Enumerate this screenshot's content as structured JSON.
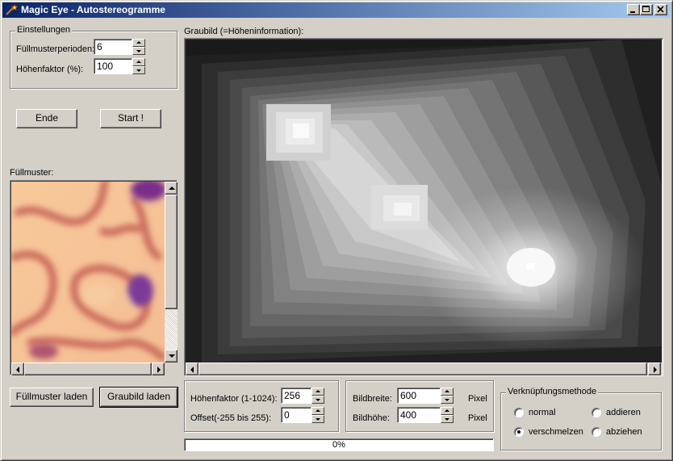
{
  "window": {
    "title": "Magic Eye - Autostereogramme"
  },
  "settings": {
    "group_label": "Einstellungen",
    "periods_label": "Füllmusterperioden:",
    "periods_value": "6",
    "height_label": "Höhenfaktor (%):",
    "height_value": "100"
  },
  "buttons": {
    "end": "Ende",
    "start": "Start !",
    "load_pattern": "Füllmuster laden",
    "load_gray": "Graubild laden"
  },
  "pattern": {
    "label": "Füllmuster:"
  },
  "graybild": {
    "label": "Graubild (=Höheninformation):"
  },
  "params": {
    "height_factor_label": "Höhenfaktor (1-1024):",
    "height_factor_value": "256",
    "offset_label": "Offset(-255 bis 255):",
    "offset_value": "0"
  },
  "size": {
    "width_label": "Bildbreite:",
    "width_value": "600",
    "height_label": "Bildhöhe:",
    "height_value": "400",
    "unit_width": "Pixel",
    "unit_height": "Pixel"
  },
  "method": {
    "group_label": "Verknüpfungsmethode",
    "options": [
      "normal",
      "addieren",
      "verschmelzen",
      "abziehen"
    ],
    "selected": "verschmelzen"
  },
  "progress": {
    "text": "0%",
    "value": 0
  },
  "icons": {
    "app": "magic-wand-icon",
    "minimize": "minimize-icon",
    "maximize": "maximize-icon",
    "close": "close-icon"
  }
}
